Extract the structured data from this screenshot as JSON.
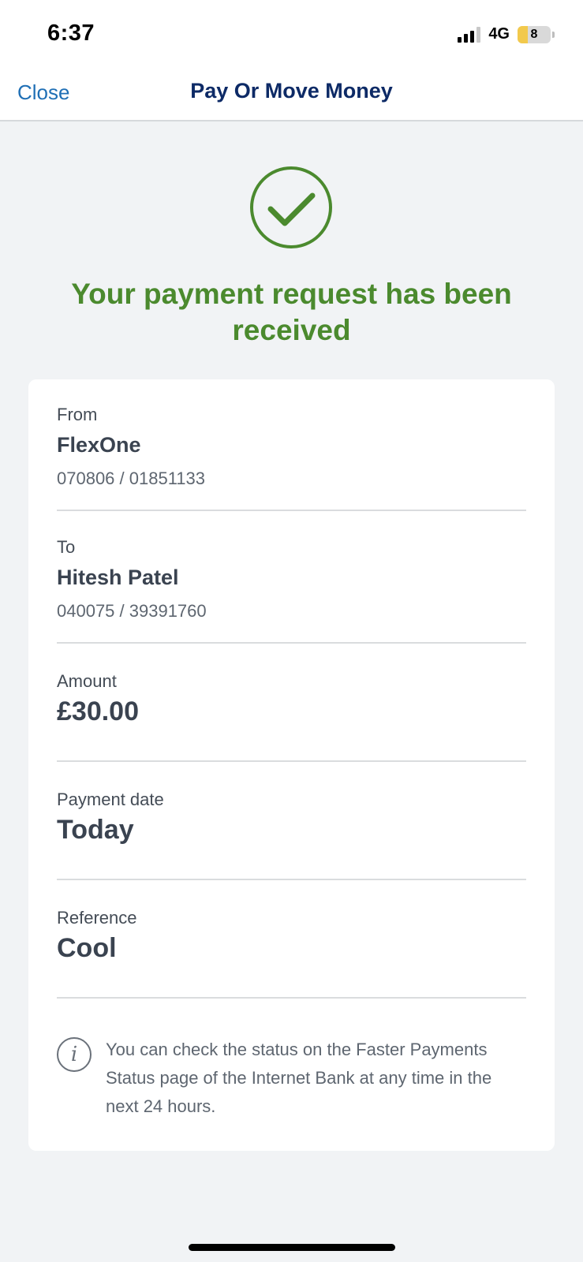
{
  "status_bar": {
    "time": "6:37",
    "network": "4G",
    "battery_level": "8"
  },
  "nav": {
    "close_label": "Close",
    "title": "Pay Or Move Money"
  },
  "confirmation": {
    "title": "Your payment request has been received"
  },
  "details": {
    "from": {
      "label": "From",
      "name": "FlexOne",
      "account": "070806 / 01851133"
    },
    "to": {
      "label": "To",
      "name": "Hitesh Patel",
      "account": "040075 / 39391760"
    },
    "amount": {
      "label": "Amount",
      "value": "£30.00"
    },
    "payment_date": {
      "label": "Payment date",
      "value": "Today"
    },
    "reference": {
      "label": "Reference",
      "value": "Cool"
    }
  },
  "info": {
    "icon": "info-icon",
    "text": "You can check the status on the Faster Payments Status page of the Internet Bank at any time in the next 24 hours."
  },
  "colors": {
    "accent_blue": "#1f6fb5",
    "title_navy": "#0d2a66",
    "success_green": "#4b8a2e"
  }
}
